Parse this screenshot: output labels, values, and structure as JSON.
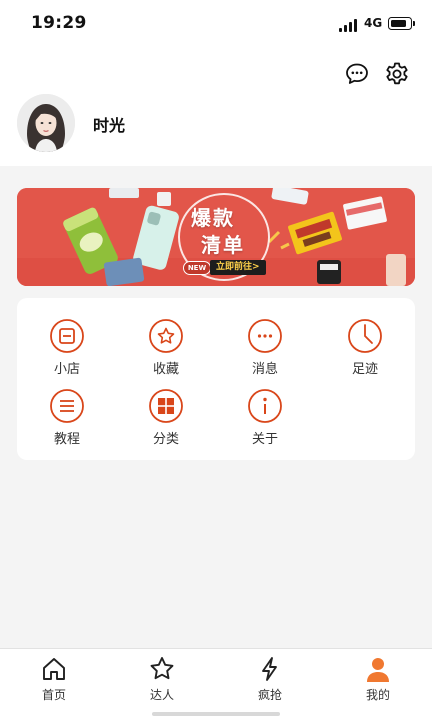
{
  "status_bar": {
    "time": "19:29",
    "network": "4G"
  },
  "profile": {
    "username": "时光"
  },
  "banner": {
    "title_line1": "爆款",
    "title_line2": "清单",
    "badge": "NEW",
    "cta": "立即前往>"
  },
  "menu": {
    "items": [
      {
        "label": "小店",
        "icon": "shop-icon"
      },
      {
        "label": "收藏",
        "icon": "star-icon"
      },
      {
        "label": "消息",
        "icon": "message-icon"
      },
      {
        "label": "足迹",
        "icon": "clock-icon"
      },
      {
        "label": "教程",
        "icon": "list-icon"
      },
      {
        "label": "分类",
        "icon": "grid-icon"
      },
      {
        "label": "关于",
        "icon": "info-icon"
      }
    ]
  },
  "tabbar": {
    "items": [
      {
        "label": "首页",
        "icon": "home-icon"
      },
      {
        "label": "达人",
        "icon": "star-outline-icon"
      },
      {
        "label": "疯抢",
        "icon": "lightning-icon"
      },
      {
        "label": "我的",
        "icon": "person-icon",
        "active": true
      }
    ]
  },
  "colors": {
    "accent": "#e05a1e",
    "tab_active": "#f07830",
    "background": "#f4f4f4"
  }
}
